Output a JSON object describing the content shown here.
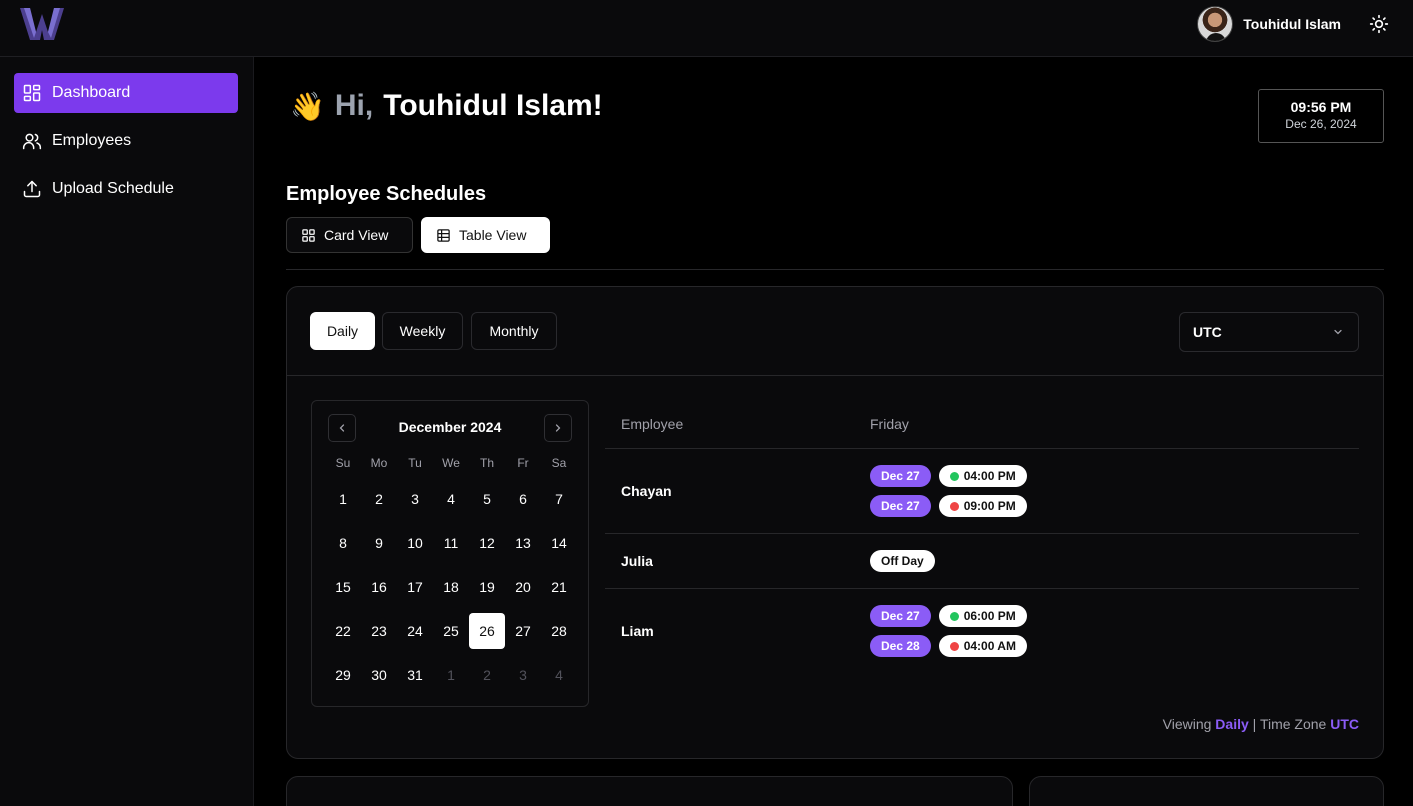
{
  "header": {
    "logo_text": "W",
    "user_name": "Touhidul Islam",
    "theme_icon": "sun-icon"
  },
  "sidebar": {
    "items": [
      {
        "label": "Dashboard",
        "icon": "dashboard-icon",
        "active": true
      },
      {
        "label": "Employees",
        "icon": "users-icon",
        "active": false
      },
      {
        "label": "Upload Schedule",
        "icon": "upload-icon",
        "active": false
      }
    ]
  },
  "greeting": {
    "emoji": "👋",
    "hi": "Hi,",
    "name": "Touhidul Islam!"
  },
  "clock": {
    "time": "09:56 PM",
    "date": "Dec 26, 2024"
  },
  "schedules": {
    "title": "Employee Schedules",
    "views": [
      "Card View",
      "Table View"
    ],
    "active_view": "Table View",
    "periods": [
      "Daily",
      "Weekly",
      "Monthly"
    ],
    "active_period": "Daily",
    "timezone": "UTC"
  },
  "calendar": {
    "title": "December 2024",
    "weekdays": [
      "Su",
      "Mo",
      "Tu",
      "We",
      "Th",
      "Fr",
      "Sa"
    ],
    "weeks": [
      [
        "1",
        "2",
        "3",
        "4",
        "5",
        "6",
        "7"
      ],
      [
        "8",
        "9",
        "10",
        "11",
        "12",
        "13",
        "14"
      ],
      [
        "15",
        "16",
        "17",
        "18",
        "19",
        "20",
        "21"
      ],
      [
        "22",
        "23",
        "24",
        "25",
        "26",
        "27",
        "28"
      ],
      [
        "29",
        "30",
        "31",
        "1",
        "2",
        "3",
        "4"
      ]
    ],
    "outside_days_last_week": 4,
    "selected": "26"
  },
  "table": {
    "col_employee": "Employee",
    "col_day": "Friday",
    "rows": [
      {
        "name": "Chayan",
        "shifts": [
          {
            "date": "Dec 27",
            "time": "04:00 PM",
            "status": "start"
          },
          {
            "date": "Dec 27",
            "time": "09:00 PM",
            "status": "end"
          }
        ]
      },
      {
        "name": "Julia",
        "off": "Off Day"
      },
      {
        "name": "Liam",
        "shifts": [
          {
            "date": "Dec 27",
            "time": "06:00 PM",
            "status": "start"
          },
          {
            "date": "Dec 28",
            "time": "04:00 AM",
            "status": "end"
          }
        ]
      }
    ]
  },
  "footer": {
    "viewing_label": "Viewing",
    "viewing_value": "Daily",
    "separator": "|",
    "tz_label": "Time Zone",
    "tz_value": "UTC"
  },
  "colors": {
    "accent": "#7c3aed",
    "badge": "#8b5cf6",
    "start_dot": "#22c55e",
    "end_dot": "#ef4444"
  }
}
